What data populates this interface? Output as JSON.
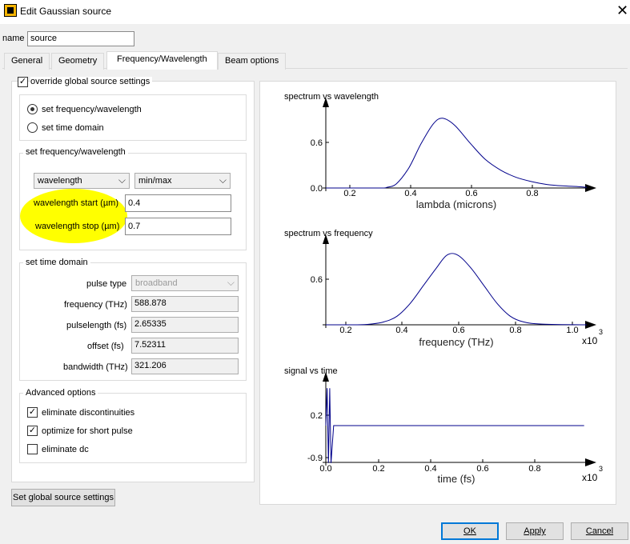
{
  "window": {
    "title": "Edit Gaussian source",
    "close_glyph": "✕"
  },
  "name_field": {
    "label": "name",
    "value": "source"
  },
  "tabs": [
    {
      "label": "General"
    },
    {
      "label": "Geometry"
    },
    {
      "label": "Frequency/Wavelength",
      "active": true
    },
    {
      "label": "Beam options"
    }
  ],
  "override": {
    "label": "override global source settings",
    "checked": true
  },
  "mode": {
    "options": [
      {
        "label": "set frequency/wavelength",
        "selected": true
      },
      {
        "label": "set time domain",
        "selected": false
      }
    ]
  },
  "freq_wavelength": {
    "title": "set frequency/wavelength",
    "type_select": "wavelength",
    "range_select": "min/max",
    "start_label": "wavelength start (µm)",
    "start_value": "0.4",
    "stop_label": "wavelength stop (µm)",
    "stop_value": "0.7"
  },
  "time_domain": {
    "title": "set time domain",
    "pulse_type_label": "pulse type",
    "pulse_type_value": "broadband",
    "frequency_label": "frequency (THz)",
    "frequency_value": "588.878",
    "pulselength_label": "pulselength (fs)",
    "pulselength_value": "2.65335",
    "offset_label": "offset (fs)",
    "offset_value": "7.52311",
    "bandwidth_label": "bandwidth (THz)",
    "bandwidth_value": "321.206"
  },
  "advanced": {
    "title": "Advanced options",
    "options": [
      {
        "label": "eliminate discontinuities",
        "checked": true
      },
      {
        "label": "optimize for short pulse",
        "checked": true
      },
      {
        "label": "eliminate dc",
        "checked": false
      }
    ]
  },
  "buttons": {
    "global": "Set global source settings",
    "ok": "OK",
    "apply": "Apply",
    "cancel": "Cancel"
  },
  "colors": {
    "curve": "#00008b",
    "highlight": "#ffff00",
    "accent": "#0078d7"
  },
  "chart_data": [
    {
      "type": "line",
      "title": "spectrum vs wavelength",
      "xlabel": "lambda (microns)",
      "xlim": [
        0.13,
        0.98
      ],
      "ylim": [
        0,
        1
      ],
      "xticks": [
        "0.2",
        "0.4",
        "0.6",
        "0.8"
      ],
      "yticks": [
        "0.0",
        "0.6"
      ],
      "x": [
        0.13,
        0.3,
        0.33,
        0.36,
        0.4,
        0.44,
        0.48,
        0.51,
        0.55,
        0.6,
        0.65,
        0.7,
        0.75,
        0.8,
        0.85,
        0.9,
        0.95,
        0.98
      ],
      "y": [
        0,
        0,
        0.01,
        0.06,
        0.28,
        0.62,
        0.9,
        0.98,
        0.88,
        0.63,
        0.4,
        0.25,
        0.15,
        0.09,
        0.05,
        0.03,
        0.02,
        0.01
      ]
    },
    {
      "type": "line",
      "title": "spectrum vs frequency",
      "xlabel": "frequency (THz)",
      "multiplier": "x10",
      "exponent": "3",
      "xlim": [
        0.13,
        1.12
      ],
      "ylim": [
        0,
        1
      ],
      "xticks": [
        "0.2",
        "0.4",
        "0.6",
        "0.8",
        "1.0"
      ],
      "yticks": [
        "0.6"
      ],
      "x": [
        0.13,
        0.25,
        0.3,
        0.35,
        0.4,
        0.45,
        0.5,
        0.55,
        0.59,
        0.63,
        0.68,
        0.73,
        0.78,
        0.83,
        0.88,
        0.95,
        1.12
      ],
      "y": [
        0,
        0,
        0.01,
        0.04,
        0.12,
        0.3,
        0.55,
        0.8,
        0.98,
        0.98,
        0.8,
        0.55,
        0.3,
        0.12,
        0.04,
        0.01,
        0
      ]
    },
    {
      "type": "line",
      "title": "signal vs time",
      "xlabel": "time (fs)",
      "multiplier": "x10",
      "exponent": "3",
      "xlim": [
        0,
        1.0
      ],
      "ylim": [
        -1,
        1
      ],
      "xticks": [
        "0.0",
        "0.2",
        "0.4",
        "0.6",
        "0.8"
      ],
      "yticks": [
        "0.2",
        "-0.9"
      ],
      "x": [
        0.0,
        0.005,
        0.01,
        0.015,
        0.02,
        0.03,
        0.5,
        0.99
      ],
      "y": [
        0,
        0.9,
        -0.9,
        0.9,
        -0.9,
        0,
        0,
        0
      ]
    }
  ]
}
